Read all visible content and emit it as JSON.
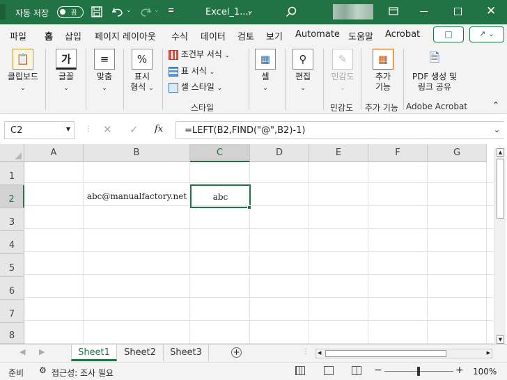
{
  "titlebar": {
    "autosave_label": "자동 저장",
    "autosave_state": "끔",
    "filename": "Excel_1...."
  },
  "tabs": [
    "파일",
    "홈",
    "삽입",
    "페이지 레이아웃",
    "수식",
    "데이터",
    "검토",
    "보기",
    "Automate",
    "도움말",
    "Acrobat"
  ],
  "ribbon": {
    "clipboard": "클립보드",
    "font": "글꼴",
    "font_icon": "가",
    "align": "맞춤",
    "number_l1": "표시",
    "number_l2": "형식",
    "cond_format": "조건부 서식",
    "table_format": "표 서식",
    "cell_style": "셀 스타일",
    "style_group": "스타일",
    "cells": "셀",
    "editing": "편집",
    "sensitivity": "민감도",
    "sensitivity_group": "민감도",
    "addins_l1": "추가",
    "addins_l2": "기능",
    "addins_group": "추가 기능",
    "pdf_l1": "PDF 생성 및",
    "pdf_l2": "링크 공유",
    "pdf_group": "Adobe Acrobat"
  },
  "formula_bar": {
    "name_box": "C2",
    "fx": "fx",
    "formula": "=LEFT(B2,FIND(\"@\",B2)-1)"
  },
  "grid": {
    "columns": [
      "A",
      "B",
      "C",
      "D",
      "E",
      "F",
      "G"
    ],
    "rows": [
      "1",
      "2",
      "3",
      "4",
      "5",
      "6",
      "7",
      "8"
    ],
    "cells": {
      "B2": "abc@manualfactory.net",
      "C2": "abc"
    }
  },
  "sheets": [
    "Sheet1",
    "Sheet2",
    "Sheet3"
  ],
  "active_sheet": "Sheet1",
  "status": {
    "ready": "준비",
    "accessibility": "접근성: 조사 필요",
    "zoom": "100%"
  },
  "colors": {
    "accent": "#217346",
    "ribbon_bg": "#f3f3f3"
  }
}
